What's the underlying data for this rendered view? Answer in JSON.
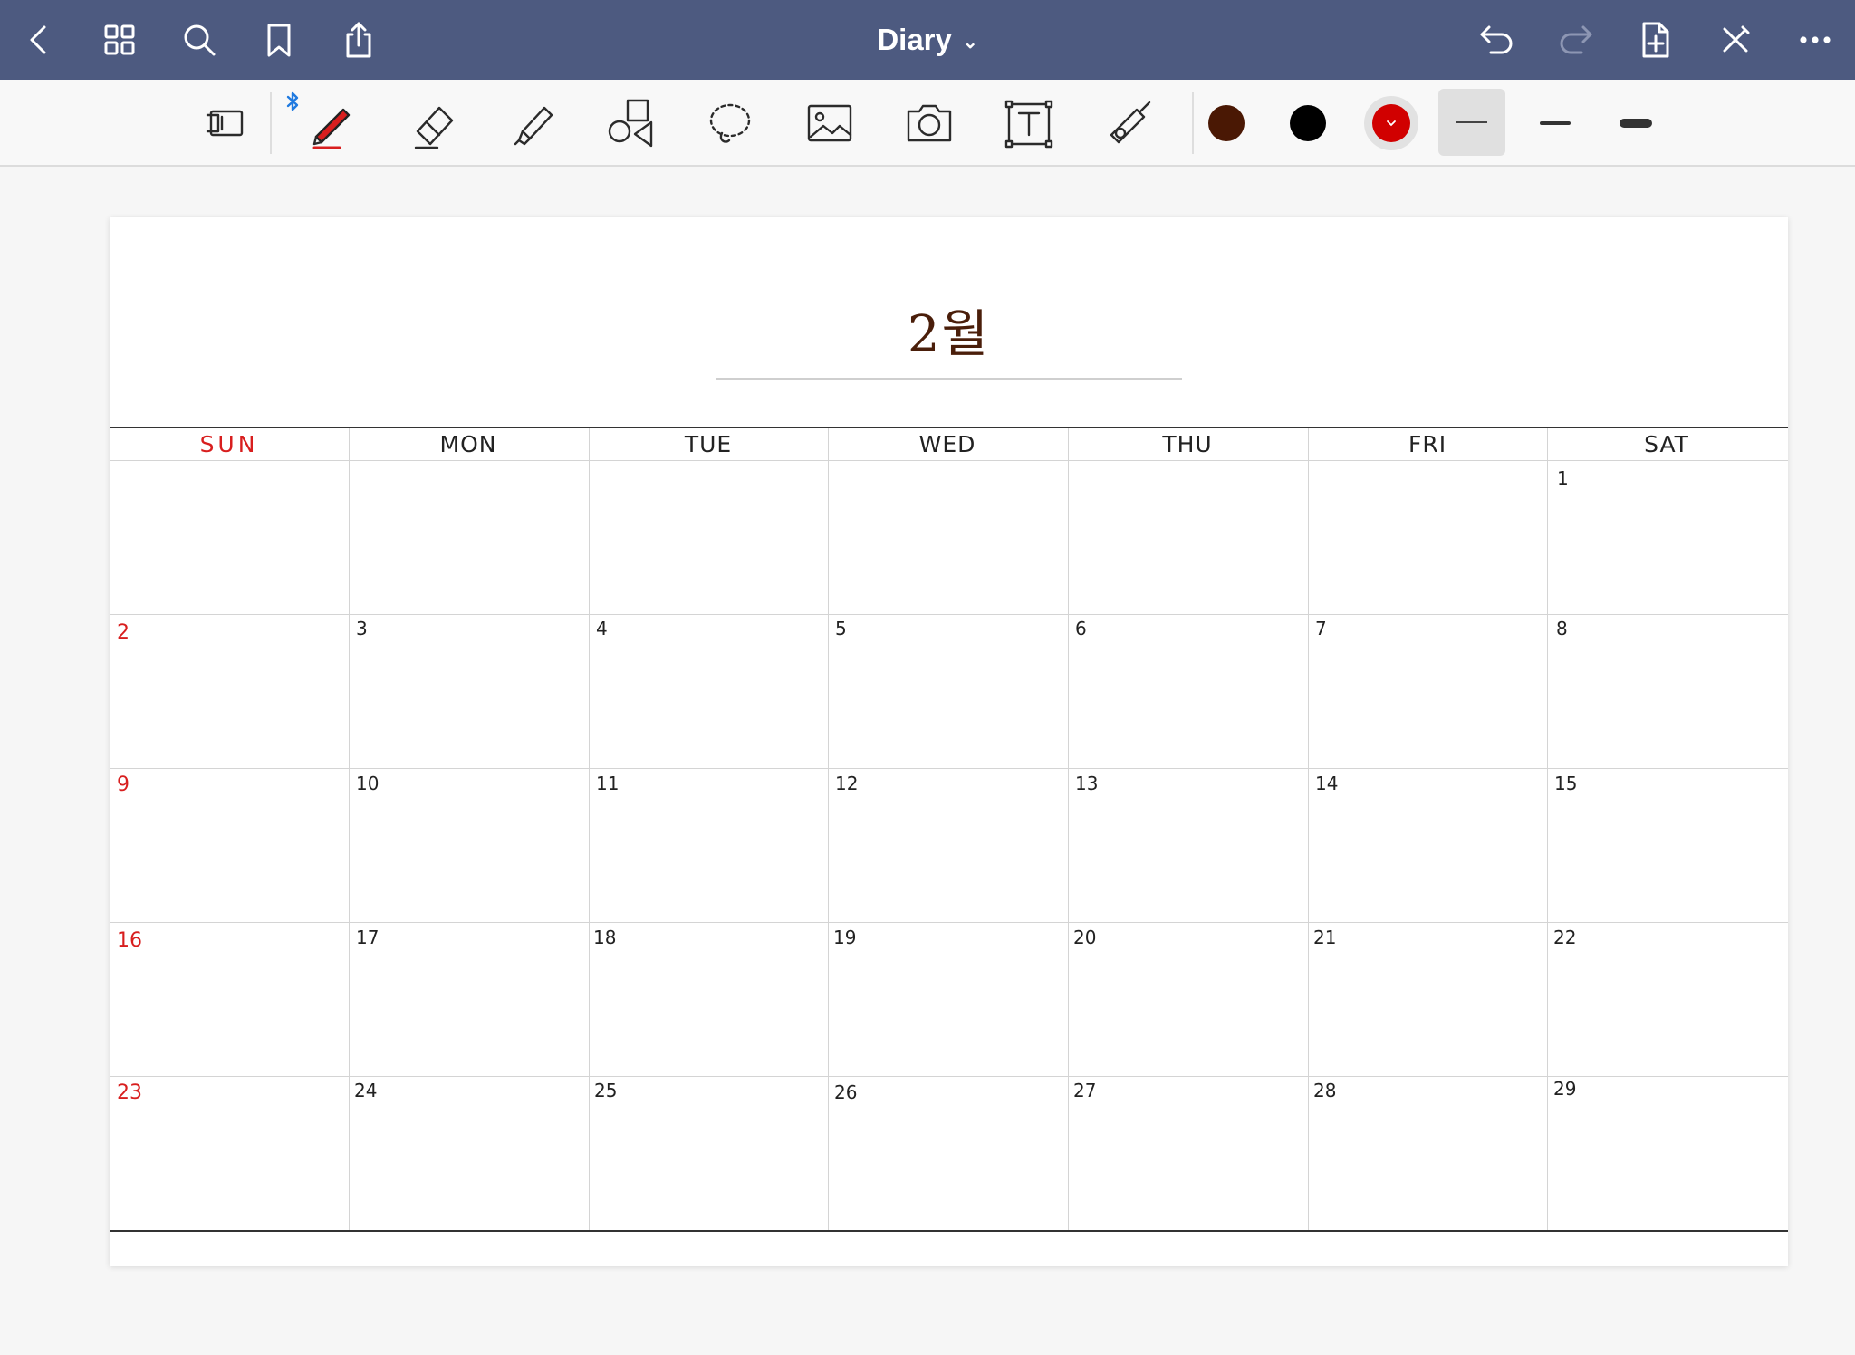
{
  "topbar": {
    "title": "Diary",
    "title_chevron": "⌄",
    "icons": [
      "back-icon",
      "grid-view-icon",
      "search-icon",
      "bookmark-icon",
      "share-icon",
      "undo-icon",
      "redo-icon",
      "add-page-icon",
      "close-pen-icon",
      "more-icon"
    ]
  },
  "toolbar": {
    "tools": [
      "pen-settings",
      "pen",
      "eraser",
      "highlighter",
      "shapes",
      "lasso",
      "image",
      "camera",
      "text",
      "laser-pointer"
    ],
    "bluetooth": true,
    "colors": {
      "brown": "#4a1804",
      "black": "#000000",
      "red": "#d10000",
      "accent": "#4d5a80"
    },
    "selected_color": "red",
    "selected_thickness": "thin"
  },
  "calendar": {
    "month_title": "2월",
    "days": [
      "SUN",
      "MON",
      "TUE",
      "WED",
      "THU",
      "FRI",
      "SAT"
    ],
    "weeks": [
      [
        "",
        "",
        "",
        "",
        "",
        "",
        "1"
      ],
      [
        "2",
        "3",
        "4",
        "5",
        "6",
        "7",
        "8"
      ],
      [
        "9",
        "10",
        "11",
        "12",
        "13",
        "14",
        "15"
      ],
      [
        "16",
        "17",
        "18",
        "19",
        "20",
        "21",
        "22"
      ],
      [
        "23",
        "24",
        "25",
        "26",
        "27",
        "28",
        "29"
      ]
    ]
  }
}
